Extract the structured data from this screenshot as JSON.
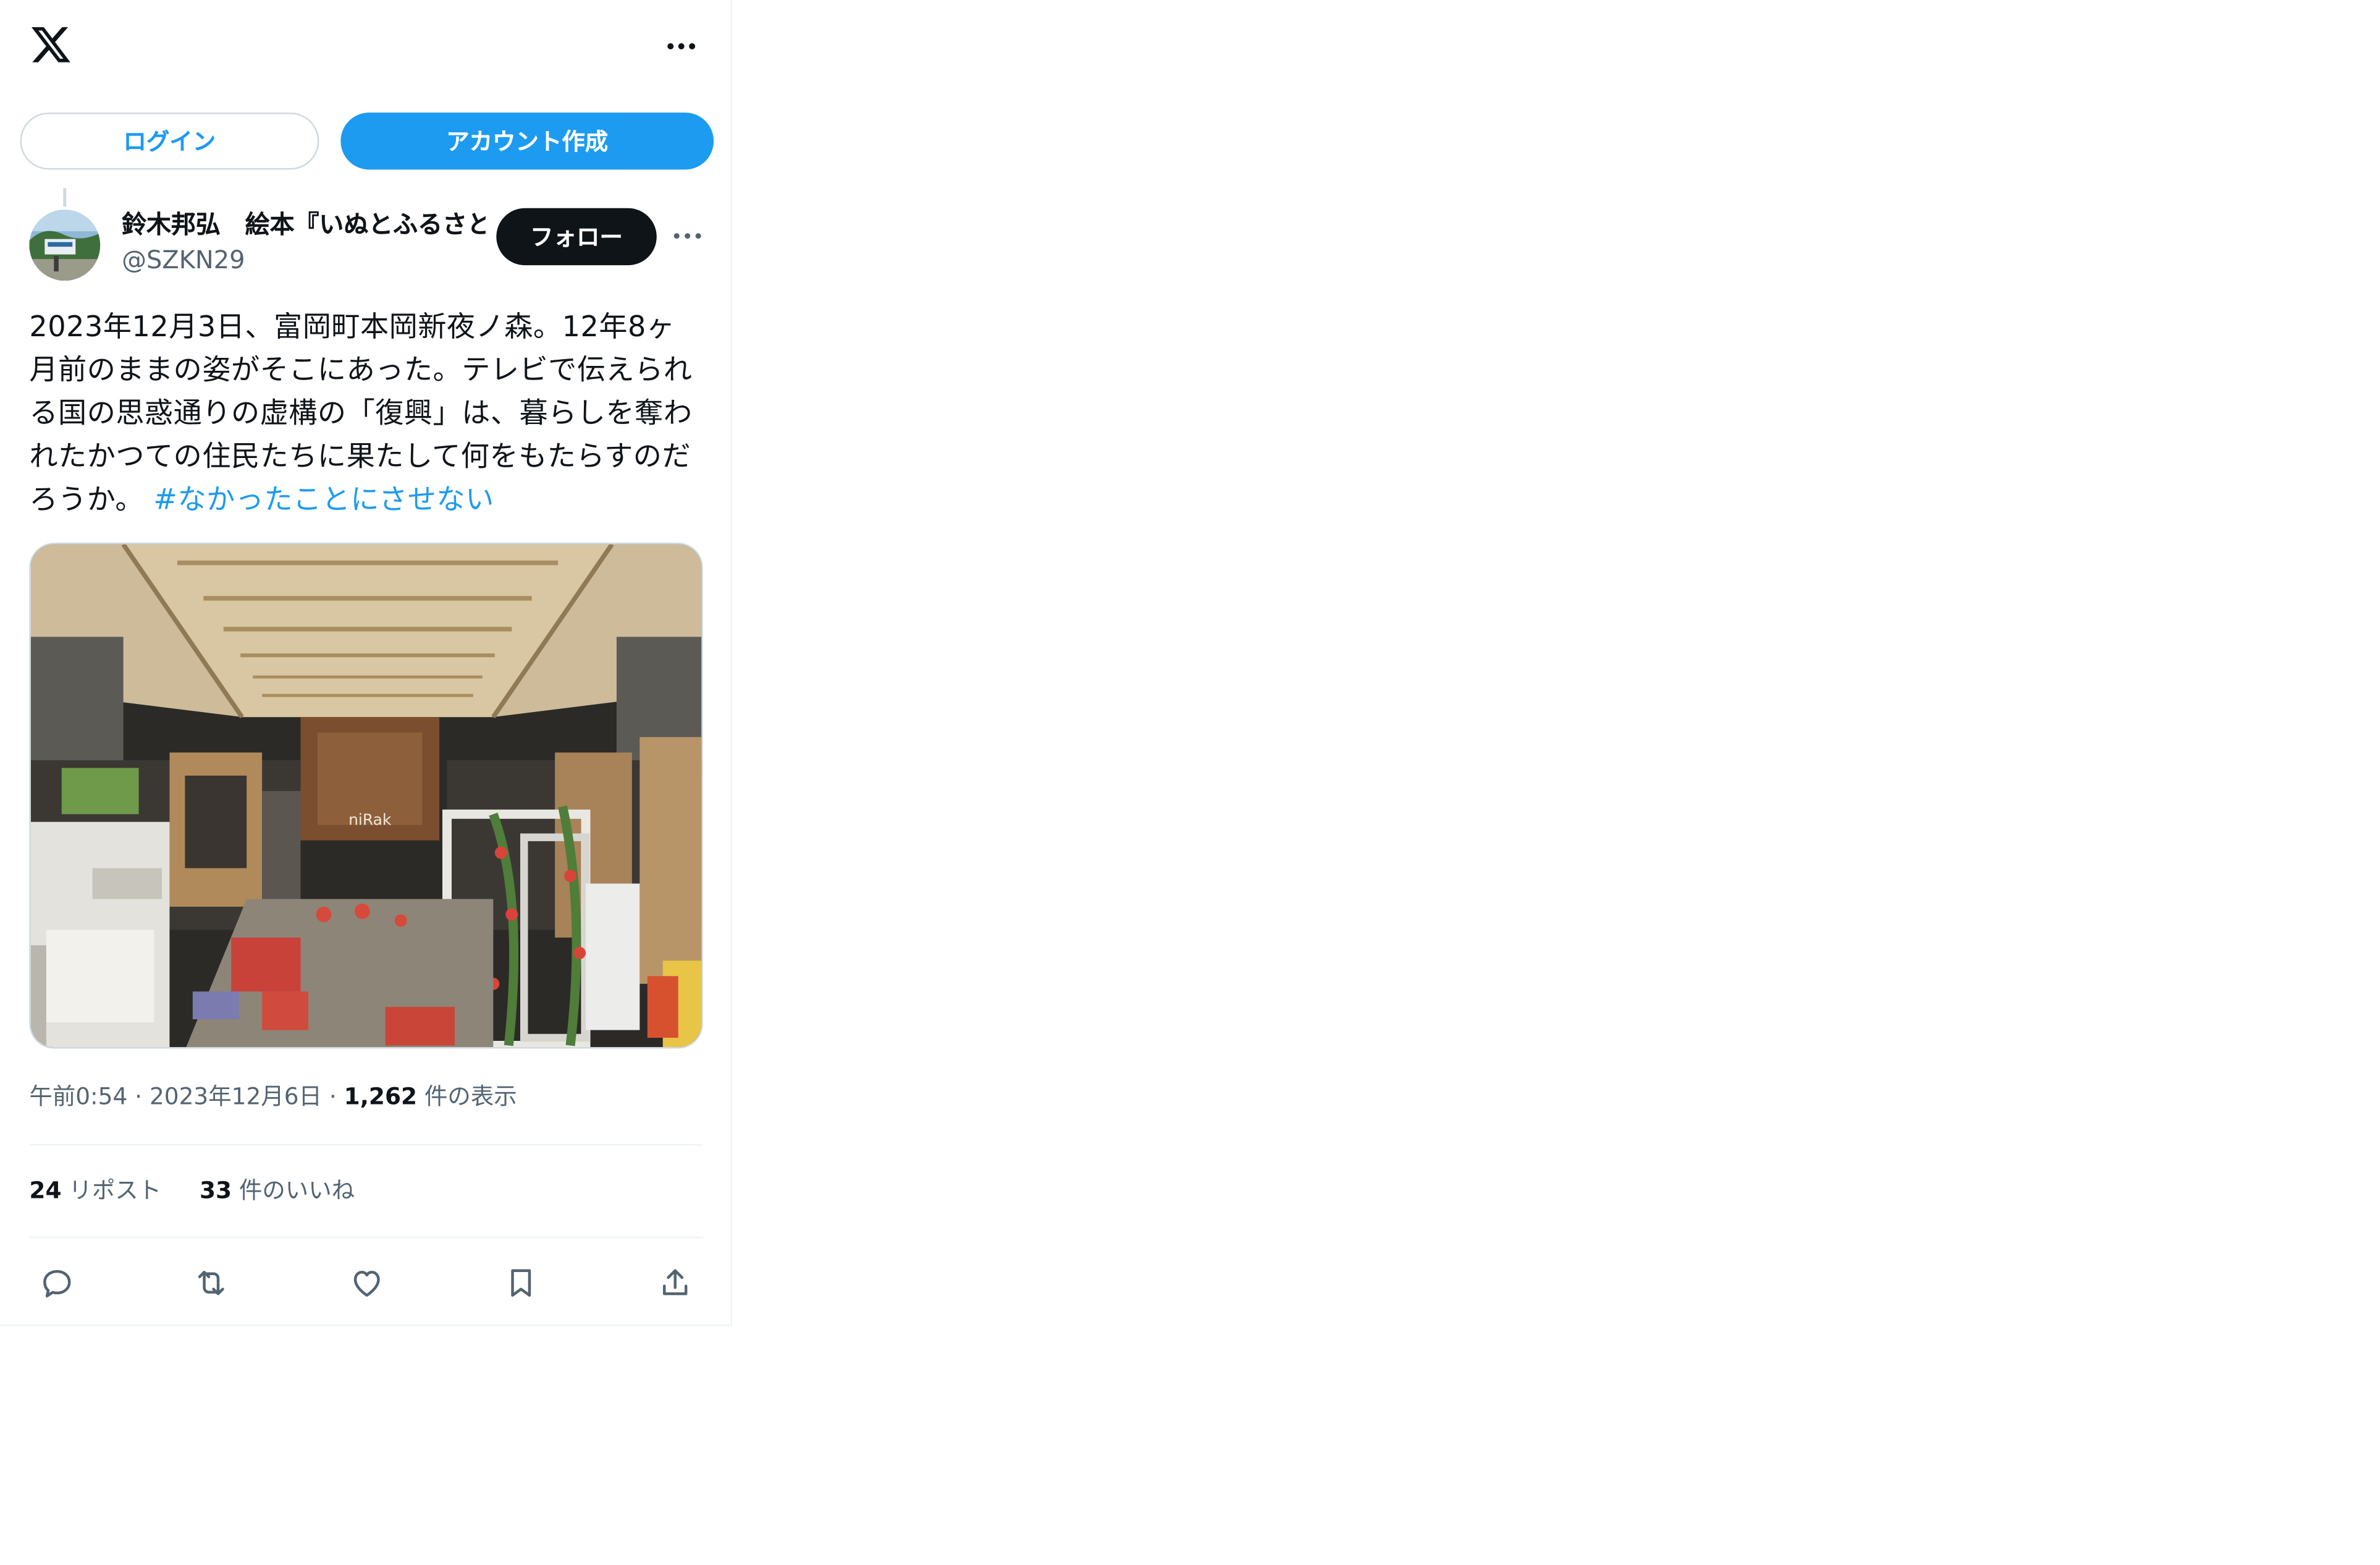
{
  "header": {
    "logo_icon": "x-logo-icon",
    "more_icon": "more-dots-icon"
  },
  "auth": {
    "login_label": "ログイン",
    "signup_label": "アカウント作成"
  },
  "tweet": {
    "author_name": "鈴木邦弘　絵本『いぬとふるさと』",
    "author_handle": "@SZKN29",
    "follow_label": "フォロー",
    "text": "2023年12月3日、富岡町本岡新夜ノ森。12年8ヶ月前のままの姿がそこにあった。テレビで伝えられる国の思惑通りの虚構の「復興」は、暮らしを奪われたかつての住民たちに果たして何をもたらすのだろうか。",
    "hashtag": "#なかったことにさせない",
    "time": "午前0:54",
    "date": "2023年12月6日",
    "views_count": "1,262",
    "views_label": "件の表示",
    "reposts_count": "24",
    "reposts_label": "リポスト",
    "likes_count": "33",
    "likes_label": "件のいいね"
  },
  "media_sign_text": "niRak",
  "actions": {
    "reply_icon": "reply-icon",
    "repost_icon": "repost-icon",
    "like_icon": "like-icon",
    "bookmark_icon": "bookmark-icon",
    "share_icon": "share-icon"
  },
  "colors": {
    "accent": "#1d9bf0",
    "text": "#0f1419",
    "secondary": "#536471",
    "border": "#cfd9de",
    "divider": "#eff3f4"
  }
}
